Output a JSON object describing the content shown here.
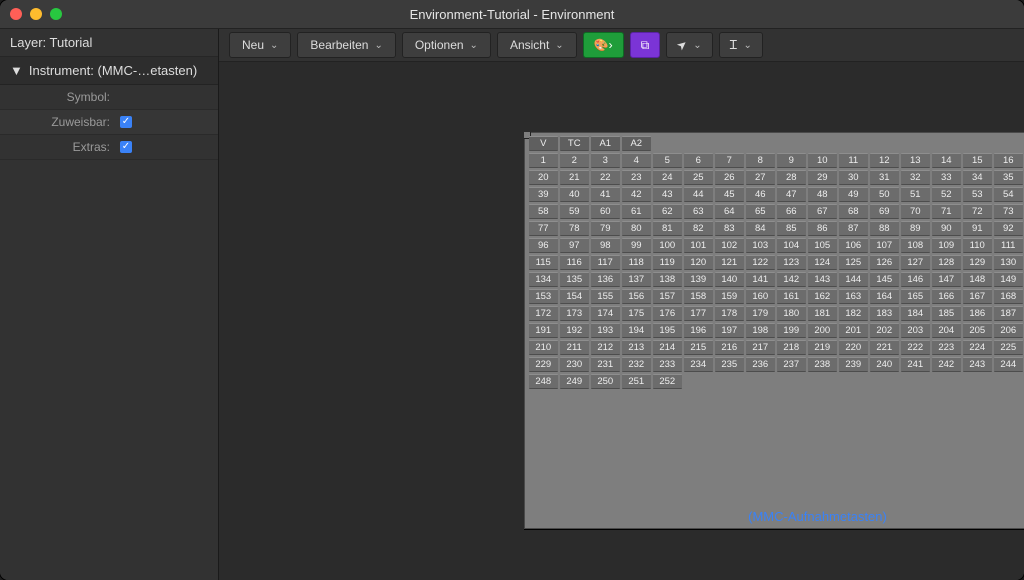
{
  "window_title": "Environment-Tutorial - Environment",
  "sidebar": {
    "layer_label": "Layer:",
    "layer_value": "Tutorial",
    "inspector_title": "Instrument: (MMC-…etasten)",
    "props": [
      {
        "label": "Symbol:",
        "value": "",
        "checkbox": null
      },
      {
        "label": "Zuweisbar:",
        "value": "",
        "checkbox": true
      },
      {
        "label": "Extras:",
        "value": "",
        "checkbox": true
      }
    ]
  },
  "toolbar": {
    "menus": [
      "Neu",
      "Bearbeiten",
      "Optionen",
      "Ansicht"
    ]
  },
  "object": {
    "caption": "(MMC-Aufnahmetasten)",
    "header_cells": [
      "V",
      "TC",
      "A1",
      "A2"
    ]
  },
  "chart_data": {
    "type": "table",
    "columns": 19,
    "header": [
      "V",
      "TC",
      "A1",
      "A2"
    ],
    "max_number": 252
  }
}
